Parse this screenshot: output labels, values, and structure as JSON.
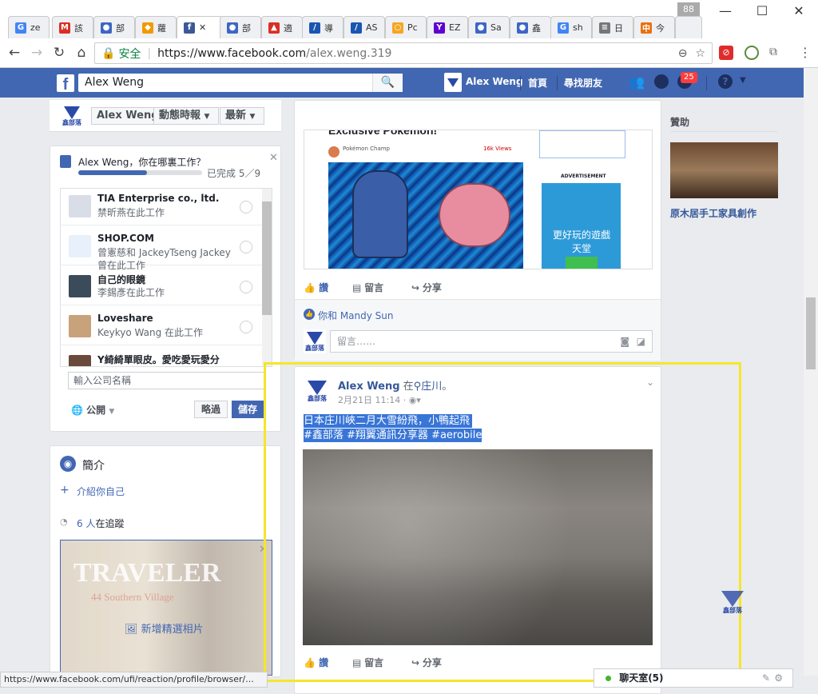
{
  "browser": {
    "tabs": [
      {
        "label": "ze",
        "icon": "G",
        "color": "#4285f4"
      },
      {
        "label": "該",
        "icon": "M",
        "color": "#d93025"
      },
      {
        "label": "部",
        "icon": "●",
        "color": "#3d66c4"
      },
      {
        "label": "蘿",
        "icon": "◆",
        "color": "#f29900"
      },
      {
        "label": "✕",
        "icon": "f",
        "color": "#3b5998"
      },
      {
        "label": "部",
        "icon": "●",
        "color": "#3d66c4"
      },
      {
        "label": "適",
        "icon": "▲",
        "color": "#d93025"
      },
      {
        "label": "導",
        "icon": "/",
        "color": "#1a56b0"
      },
      {
        "label": "AS",
        "icon": "/",
        "color": "#1a56b0"
      },
      {
        "label": "Pc",
        "icon": "○",
        "color": "#f5a623"
      },
      {
        "label": "EZ",
        "icon": "Y",
        "color": "#6001d2"
      },
      {
        "label": "Sa",
        "icon": "●",
        "color": "#3d66c4"
      },
      {
        "label": "鑫",
        "icon": "●",
        "color": "#3d66c4"
      },
      {
        "label": "sh",
        "icon": "G",
        "color": "#4285f4"
      },
      {
        "label": "日",
        "icon": "≡",
        "color": "#777777"
      },
      {
        "label": "今",
        "icon": "中",
        "color": "#e8710a"
      }
    ],
    "tab_count": "88",
    "secure_label": "安全",
    "url_host": "https://www.facebook.com",
    "url_path": "/alex.weng.319",
    "status_url": "https://www.facebook.com/ufi/reaction/profile/browser/..."
  },
  "fb": {
    "search_value": "Alex Weng",
    "user_name": "Alex Weng",
    "home": "首頁",
    "find_friends": "尋找朋友",
    "notif_count": "25"
  },
  "profile_nav": {
    "name": "Alex Weng",
    "timeline": "動態時報",
    "recent": "最新"
  },
  "work": {
    "prompt": "Alex Weng，你在哪裏工作？",
    "progress_label": "已完成 5／9",
    "progress": 0.556,
    "items": [
      {
        "name": "TIA Enterprise co., ltd.",
        "sub1": "禁昕燕在此工作",
        "sub2": "",
        "thumb": "#d8dde8"
      },
      {
        "name": "SHOP.COM",
        "sub1": "曾憲慈和 JackeyTseng Jackey",
        "sub2": "曾在此工作",
        "thumb": "#e8f0fb"
      },
      {
        "name": "自己的眼鏡",
        "sub1": "李錫彥在此工作",
        "sub2": "",
        "thumb": "#3b4b5a"
      },
      {
        "name": "Loveshare",
        "sub1": "Keykyo Wang 在此工作",
        "sub2": "",
        "thumb": "#c8a27a"
      },
      {
        "name": "Y綺綺單眼皮。愛吃愛玩愛分",
        "sub1": "",
        "sub2": "",
        "thumb": "#6a4a3a"
      }
    ],
    "input_placeholder": "輸入公司名稱",
    "privacy": "公開",
    "skip": "略過",
    "save": "儲存"
  },
  "intro": {
    "title": "簡介",
    "add_intro": "介紹你自己",
    "followers_count": "6 人",
    "followers_suffix": "在追蹤",
    "magazine_title": "TRAVELER",
    "magazine_sub": "44 Southern Village",
    "add_photo": "新增精選相片"
  },
  "feed_top": {
    "headline": "Exclusive Pokemon!",
    "source": "Pokémon Champ",
    "views": "16k Views",
    "ad_label": "ADVERTISEMENT",
    "ad_text": "更好玩的遊戲天堂",
    "like": "讚",
    "comment": "留言",
    "share": "分享",
    "liked_by": "你和 Mandy Sun",
    "comment_placeholder": "留言……"
  },
  "post": {
    "author": "Alex Weng",
    "at_word": "在",
    "place": "庄川",
    "place_suffix": "。",
    "time": "2月21日 11:14 ·",
    "text1": "日本庄川峽二月大雪紛飛，小鴨起飛",
    "text2": "#鑫部落 #翔翼通訊分享器 #aerobile",
    "watermark": "鑫部落",
    "like": "讚",
    "comment": "留言",
    "share": "分享"
  },
  "sponsor": {
    "heading": "贊助",
    "ad_title": "原木居手工家具創作"
  },
  "chat": {
    "label": "聊天室(5)"
  },
  "logo_text": "鑫部落"
}
